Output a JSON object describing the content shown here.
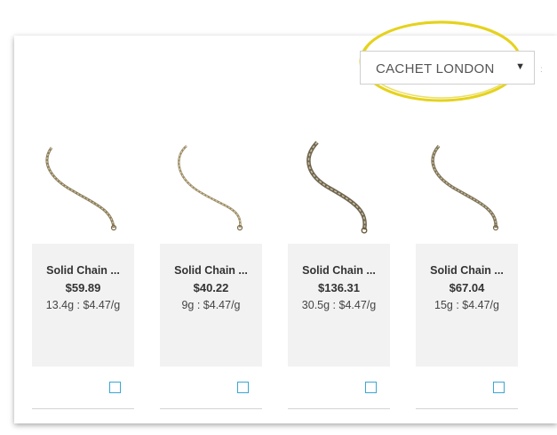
{
  "filter": {
    "brand_selected": "CACHET LONDON",
    "chevron_icon": "chevron-down-icon"
  },
  "highlight_color": "#e5d21d",
  "products": [
    {
      "name": "Solid Chain ...",
      "price": "$59.89",
      "weight": "13.4g : $4.47/g"
    },
    {
      "name": "Solid Chain ...",
      "price": "$40.22",
      "weight": "9g : $4.47/g"
    },
    {
      "name": "Solid Chain ...",
      "price": "$136.31",
      "weight": "30.5g : $4.47/g"
    },
    {
      "name": "Solid Chain ...",
      "price": "$67.04",
      "weight": "15g : $4.47/g"
    }
  ],
  "checkbox_color": "#3aa6d4"
}
